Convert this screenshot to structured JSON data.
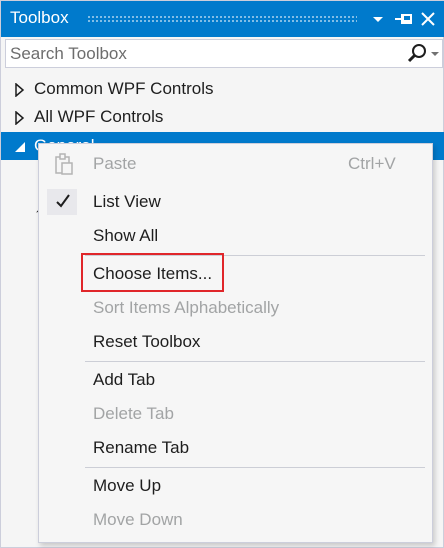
{
  "window": {
    "title": "Toolbox"
  },
  "titlebar_buttons": {
    "dropdown_icon": "dropdown-arrow",
    "pin_icon": "pin",
    "close_icon": "close"
  },
  "search": {
    "placeholder": "Search Toolbox",
    "value": "",
    "icon": "search-magnifier"
  },
  "tree": {
    "items": [
      {
        "label": "Common WPF Controls",
        "expanded": false,
        "selected": false
      },
      {
        "label": "All WPF Controls",
        "expanded": false,
        "selected": false
      },
      {
        "label": "General",
        "expanded": true,
        "selected": true
      }
    ]
  },
  "context_menu": {
    "items": [
      {
        "label": "Paste",
        "shortcut": "Ctrl+V",
        "enabled": false,
        "icon": "paste-icon"
      },
      {
        "label": "List View",
        "enabled": true,
        "checked": true
      },
      {
        "label": "Show All",
        "enabled": true
      },
      {
        "label": "Choose Items...",
        "enabled": true,
        "highlighted": true
      },
      {
        "label": "Sort Items Alphabetically",
        "enabled": false
      },
      {
        "label": "Reset Toolbox",
        "enabled": true
      },
      {
        "label": "Add Tab",
        "enabled": true
      },
      {
        "label": "Delete Tab",
        "enabled": false
      },
      {
        "label": "Rename Tab",
        "enabled": true
      },
      {
        "label": "Move Up",
        "enabled": true
      },
      {
        "label": "Move Down",
        "enabled": false
      }
    ]
  },
  "colors": {
    "accent": "#007acc",
    "disabled_text": "#a2a4a5",
    "highlight_border": "#e0262a"
  }
}
